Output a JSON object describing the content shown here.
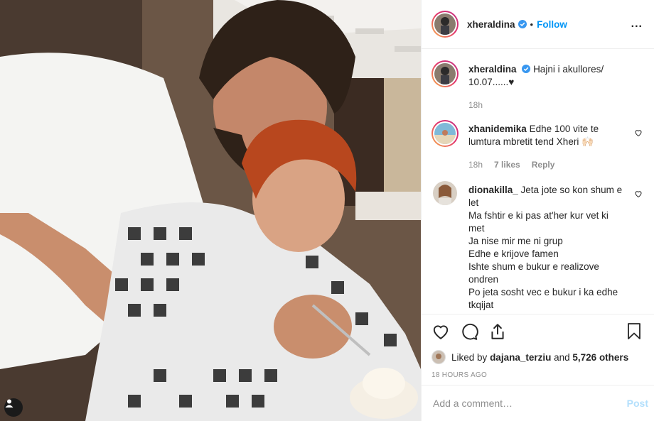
{
  "post": {
    "username": "xheraldina",
    "follow_label": "Follow",
    "dot": "•",
    "more": "...",
    "caption_user": "xheraldina",
    "caption_text": "Hajni i akullores/ 10.07......♥",
    "caption_time": "18h"
  },
  "comments": [
    {
      "user": "xhanidemika",
      "text": "Edhe 100 vite te lumtura mbretit tend Xheri 🙌🏻",
      "time": "18h",
      "likes": "7 likes",
      "reply": "Reply"
    },
    {
      "user": "dionakilla_",
      "lines": [
        "Jeta jote so kon shum e let",
        "Ma fshtir e ki pas at'her kur vet ki met",
        "Ja nise mir me ni grup",
        "Edhe e krijove famen",
        "Ishte shum e bukur e realizove ondren",
        "Po jeta sosht vec e bukur i ka edhe tkqijat"
      ]
    }
  ],
  "likes": {
    "prefix": "Liked by",
    "user": "dajana_terziu",
    "middle": "and",
    "count": "5,726 others"
  },
  "time_ago": "18 HOURS AGO",
  "add_comment": {
    "placeholder": "Add a comment…",
    "post_label": "Post"
  },
  "colors": {
    "link_blue": "#0095f6",
    "post_disabled": "#b2dffc",
    "muted": "#8e8e8e"
  }
}
